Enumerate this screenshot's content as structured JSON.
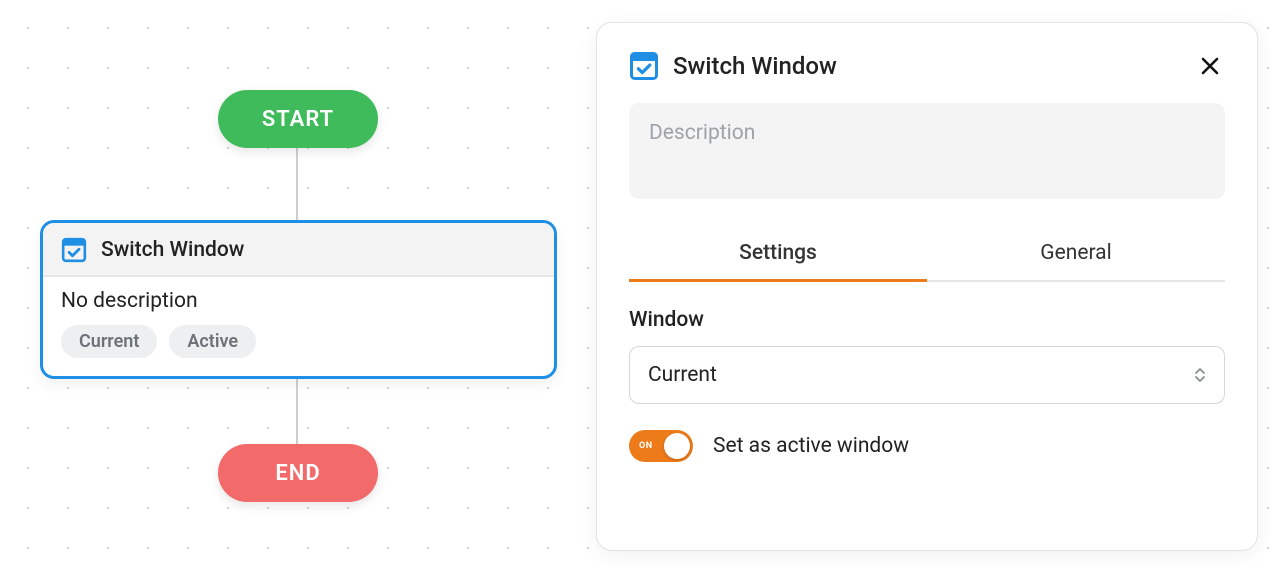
{
  "flow": {
    "start_label": "START",
    "end_label": "END",
    "node": {
      "title": "Switch Window",
      "description": "No description",
      "tags": [
        "Current",
        "Active"
      ]
    }
  },
  "panel": {
    "title": "Switch Window",
    "description_placeholder": "Description",
    "description_value": "",
    "tabs": {
      "settings": "Settings",
      "general": "General",
      "active": "settings"
    },
    "window": {
      "label": "Window",
      "value": "Current"
    },
    "toggle": {
      "state": "ON",
      "label": "Set as active window"
    }
  },
  "colors": {
    "accent": "#ee7b1a",
    "primary": "#1f8fe6",
    "start": "#3fbb5b",
    "end": "#f26a6a"
  }
}
